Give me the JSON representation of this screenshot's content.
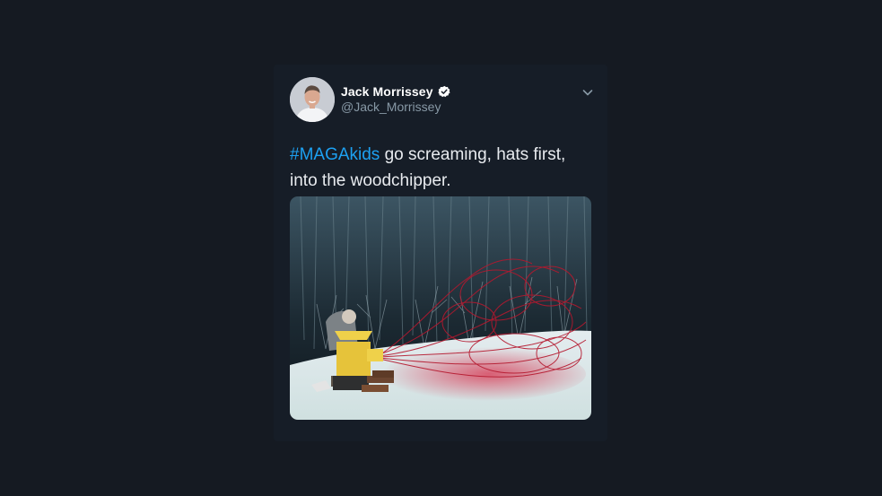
{
  "tweet": {
    "author_name": "Jack Morrissey",
    "handle": "@Jack_Morrissey",
    "verified": true,
    "hashtag": "#MAGAkids",
    "text_rest": " go screaming, hats first, into the woodchipper.",
    "icons": {
      "verified": "verified-badge-icon",
      "menu": "chevron-down-icon"
    },
    "colors": {
      "background": "#151a22",
      "card": "#161d27",
      "hashtag": "#1da1f2",
      "handle": "#8899a6",
      "text": "#e8ebef"
    }
  }
}
